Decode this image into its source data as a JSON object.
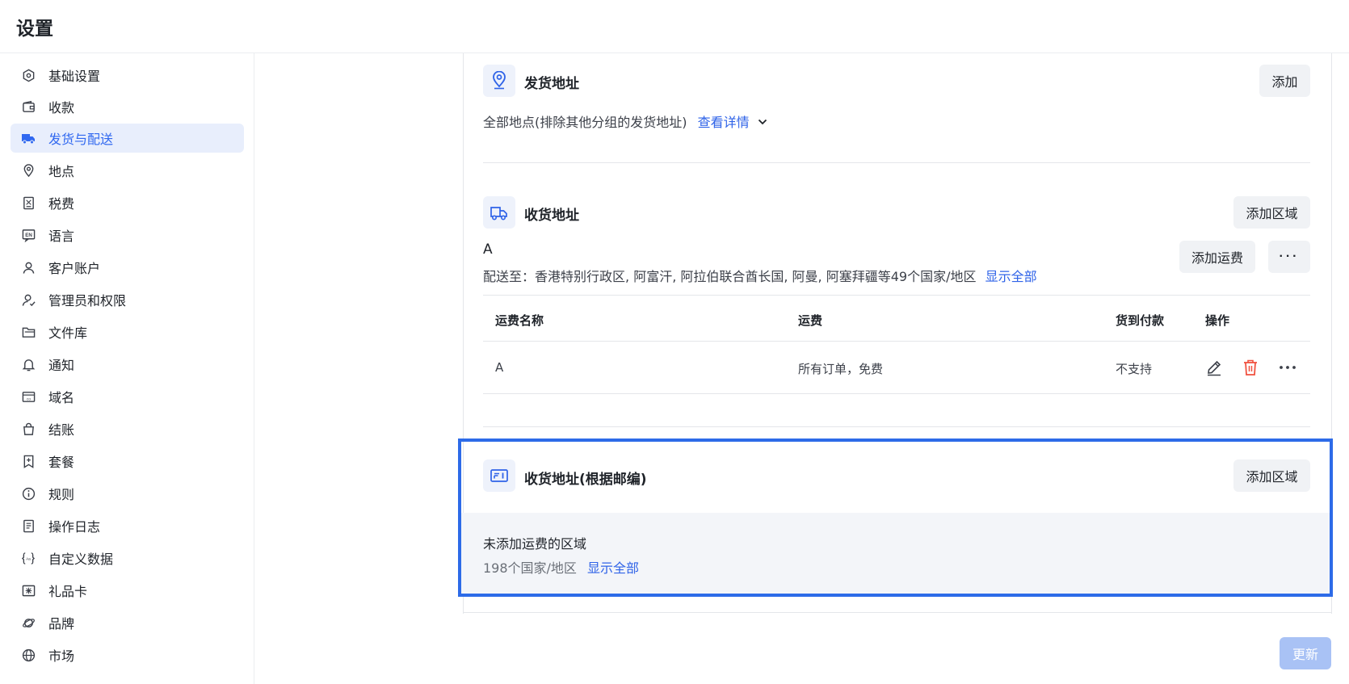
{
  "header": {
    "title": "设置"
  },
  "sidebar": {
    "items": [
      {
        "label": "基础设置",
        "icon": "hexagon-settings-icon"
      },
      {
        "label": "收款",
        "icon": "wallet-icon"
      },
      {
        "label": "发货与配送",
        "icon": "truck-icon",
        "active": true
      },
      {
        "label": "地点",
        "icon": "location-pin-icon"
      },
      {
        "label": "税费",
        "icon": "tax-receipt-icon"
      },
      {
        "label": "语言",
        "icon": "language-en-icon"
      },
      {
        "label": "客户账户",
        "icon": "user-icon"
      },
      {
        "label": "管理员和权限",
        "icon": "user-permission-icon"
      },
      {
        "label": "文件库",
        "icon": "folder-icon"
      },
      {
        "label": "通知",
        "icon": "bell-icon"
      },
      {
        "label": "域名",
        "icon": "domain-icon"
      },
      {
        "label": "结账",
        "icon": "shopping-bag-icon"
      },
      {
        "label": "套餐",
        "icon": "plan-bookmark-icon"
      },
      {
        "label": "规则",
        "icon": "info-icon"
      },
      {
        "label": "操作日志",
        "icon": "log-document-icon"
      },
      {
        "label": "自定义数据",
        "icon": "custom-data-braces-icon"
      },
      {
        "label": "礼品卡",
        "icon": "gift-card-icon"
      },
      {
        "label": "品牌",
        "icon": "brand-planet-icon"
      },
      {
        "label": "市场",
        "icon": "globe-icon"
      }
    ]
  },
  "shipping_origin": {
    "title": "发货地址",
    "add_button": "添加",
    "description": "全部地点(排除其他分组的发货地址)",
    "details_link": "查看详情"
  },
  "delivery_zones": {
    "title": "收货地址",
    "add_zone_button": "添加区域",
    "zone": {
      "name": "A",
      "ship_to_prefix": "配送至：",
      "ship_to": "香港特别行政区, 阿富汗, 阿拉伯联合酋长国, 阿曼, 阿塞拜疆等49个国家/地区",
      "show_all": "显示全部",
      "add_rate_button": "添加运费",
      "more_button": "···"
    },
    "table": {
      "headers": [
        "运费名称",
        "运费",
        "货到付款",
        "操作"
      ],
      "rows": [
        {
          "name": "A",
          "rate": "所有订单，免费",
          "cod": "不支持"
        }
      ]
    }
  },
  "postal_zones": {
    "title": "收货地址(根据邮编)",
    "add_zone_button": "添加区域",
    "unassigned_title": "未添加运费的区域",
    "unassigned_count": "198个国家/地区",
    "show_all": "显示全部"
  },
  "footer": {
    "update_button": "更新"
  },
  "colors": {
    "accent": "#2f63e8",
    "active_bg": "#e8eefc",
    "danger": "#f0513f",
    "highlight": "#2d6be8"
  }
}
